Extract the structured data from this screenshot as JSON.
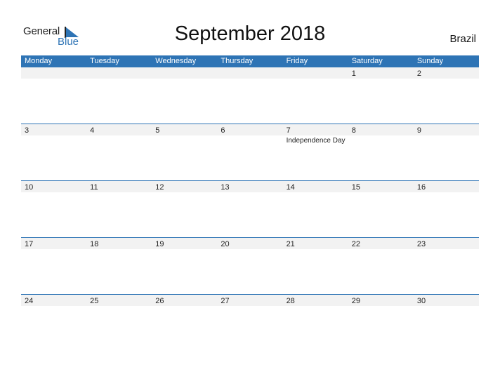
{
  "logo": {
    "line1": "General",
    "line2": "Blue"
  },
  "title": "September 2018",
  "country": "Brazil",
  "weekdays": [
    "Monday",
    "Tuesday",
    "Wednesday",
    "Thursday",
    "Friday",
    "Saturday",
    "Sunday"
  ],
  "weeks": [
    [
      {
        "day": "",
        "event": ""
      },
      {
        "day": "",
        "event": ""
      },
      {
        "day": "",
        "event": ""
      },
      {
        "day": "",
        "event": ""
      },
      {
        "day": "",
        "event": ""
      },
      {
        "day": "1",
        "event": ""
      },
      {
        "day": "2",
        "event": ""
      }
    ],
    [
      {
        "day": "3",
        "event": ""
      },
      {
        "day": "4",
        "event": ""
      },
      {
        "day": "5",
        "event": ""
      },
      {
        "day": "6",
        "event": ""
      },
      {
        "day": "7",
        "event": "Independence Day"
      },
      {
        "day": "8",
        "event": ""
      },
      {
        "day": "9",
        "event": ""
      }
    ],
    [
      {
        "day": "10",
        "event": ""
      },
      {
        "day": "11",
        "event": ""
      },
      {
        "day": "12",
        "event": ""
      },
      {
        "day": "13",
        "event": ""
      },
      {
        "day": "14",
        "event": ""
      },
      {
        "day": "15",
        "event": ""
      },
      {
        "day": "16",
        "event": ""
      }
    ],
    [
      {
        "day": "17",
        "event": ""
      },
      {
        "day": "18",
        "event": ""
      },
      {
        "day": "19",
        "event": ""
      },
      {
        "day": "20",
        "event": ""
      },
      {
        "day": "21",
        "event": ""
      },
      {
        "day": "22",
        "event": ""
      },
      {
        "day": "23",
        "event": ""
      }
    ],
    [
      {
        "day": "24",
        "event": ""
      },
      {
        "day": "25",
        "event": ""
      },
      {
        "day": "26",
        "event": ""
      },
      {
        "day": "27",
        "event": ""
      },
      {
        "day": "28",
        "event": ""
      },
      {
        "day": "29",
        "event": ""
      },
      {
        "day": "30",
        "event": ""
      }
    ]
  ],
  "colors": {
    "accent": "#2e74b5",
    "band": "#f2f2f2"
  }
}
